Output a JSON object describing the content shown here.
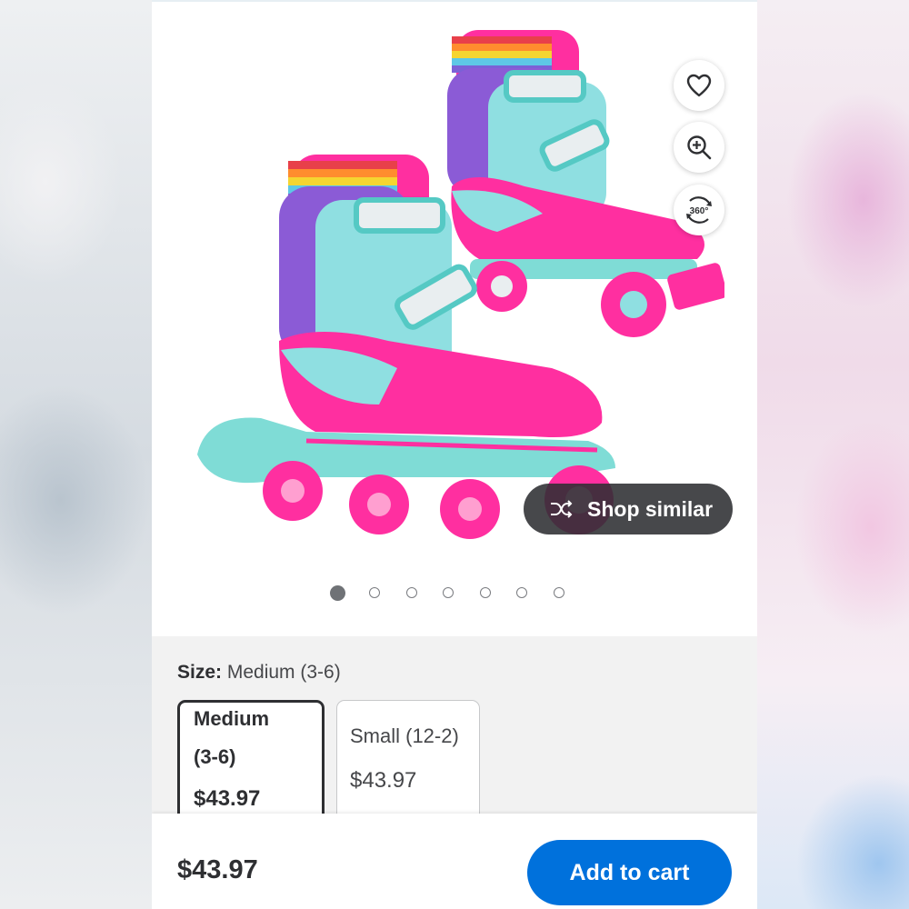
{
  "product_image": {
    "icon": "roller-skates-product-image"
  },
  "actions": {
    "favorite_icon": "heart-icon",
    "zoom_icon": "zoom-in-icon",
    "view360_label": "360°",
    "shop_similar_label": "Shop similar"
  },
  "carousel": {
    "count": 7,
    "active_index": 0
  },
  "size": {
    "key": "Size:",
    "selected_value": "Medium (3-6)",
    "options": [
      {
        "line1": "Medium",
        "line2": "(3-6)",
        "price": "$43.97",
        "selected": true
      },
      {
        "line1": "Small (12-2)",
        "price": "$43.97",
        "selected": false
      }
    ]
  },
  "bottom_bar": {
    "price": "$43.97",
    "add_to_cart_label": "Add to cart"
  },
  "colors": {
    "primary_blue": "#0071dc",
    "text_dark": "#2e2f32"
  }
}
